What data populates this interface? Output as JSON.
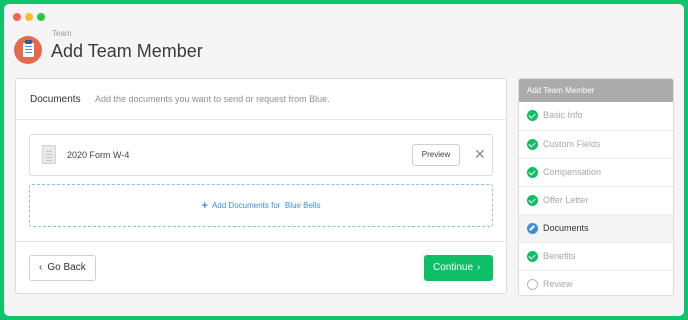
{
  "window": {
    "buttons": [
      "close",
      "minimize",
      "maximize"
    ]
  },
  "header": {
    "icon": "team-clipboard-icon",
    "breadcrumb": "Team",
    "title": "Add Team Member"
  },
  "documents": {
    "section_title": "Documents",
    "description": "Add the documents you want to send or request from Blue.",
    "items": [
      {
        "name": "2020 Form W-4",
        "preview_label": "Preview",
        "remove_label": "✕"
      }
    ],
    "add_label": "Add Documents for  Blue Bells",
    "add_icon": "+"
  },
  "footer": {
    "back_label": "Go Back",
    "continue_label": "Continue"
  },
  "steps": {
    "title": "Add Team Member",
    "items": [
      {
        "label": "Basic Info",
        "status": "done"
      },
      {
        "label": "Custom Fields",
        "status": "done"
      },
      {
        "label": "Compensation",
        "status": "done"
      },
      {
        "label": "Offer Letter",
        "status": "done"
      },
      {
        "label": "Documents",
        "status": "current"
      },
      {
        "label": "Benefits",
        "status": "done"
      },
      {
        "label": "Review",
        "status": "todo"
      }
    ]
  },
  "colors": {
    "accent_green": "#0fbf65",
    "link_blue": "#3b8fd9",
    "background_green": "#0fc46a"
  }
}
